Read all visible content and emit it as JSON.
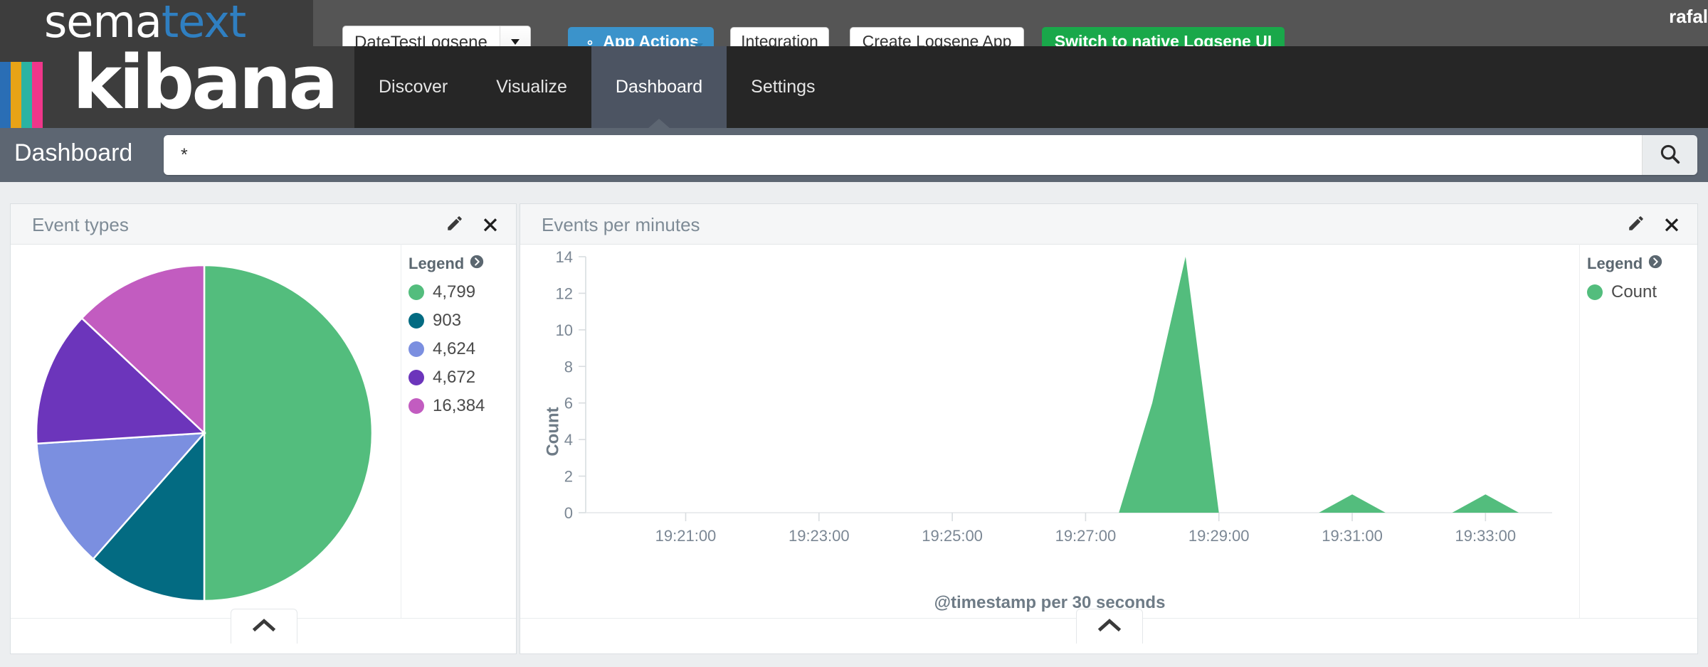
{
  "topbar": {
    "logo": {
      "part1": "sema",
      "part2": "text"
    },
    "app_select": {
      "value": "DateTestLogsene",
      "icon": "chevron-down-icon"
    },
    "buttons": [
      {
        "name": "app-actions",
        "label": "App Actions",
        "icon": "gear-icon",
        "style": "blue"
      },
      {
        "name": "integration",
        "label": "Integration",
        "style": "white"
      },
      {
        "name": "create-logsene-app",
        "label": "Create Logsene App",
        "style": "white"
      },
      {
        "name": "switch-native-ui",
        "label": "Switch to native Logsene UI",
        "style": "green"
      }
    ],
    "username": "rafal"
  },
  "kibana": {
    "logo_word": "kibana",
    "stripe_colors": [
      "#2a6eb5",
      "#e8a317",
      "#2bb3a3",
      "#f0368a"
    ],
    "tabs": [
      {
        "label": "Discover",
        "active": false
      },
      {
        "label": "Visualize",
        "active": false
      },
      {
        "label": "Dashboard",
        "active": true
      },
      {
        "label": "Settings",
        "active": false
      }
    ]
  },
  "search": {
    "page_title": "Dashboard",
    "query": "*",
    "placeholder": "",
    "button_icon": "search-icon"
  },
  "panels": [
    {
      "name": "event-types",
      "title": "Event types",
      "tools": [
        {
          "name": "edit-panel-button",
          "icon": "pencil-icon"
        },
        {
          "name": "remove-panel-button",
          "icon": "close-icon"
        }
      ],
      "legend_title": "Legend",
      "legend_icon": "arrow-circle-right-icon",
      "collapse_icon": "chevron-up-icon"
    },
    {
      "name": "events-per-minutes",
      "title": "Events per minutes",
      "tools": [
        {
          "name": "edit-panel-button",
          "icon": "pencil-icon"
        },
        {
          "name": "remove-panel-button",
          "icon": "close-icon"
        }
      ],
      "legend_title": "Legend",
      "legend_icon": "arrow-circle-right-icon",
      "collapse_icon": "chevron-up-icon"
    }
  ],
  "chart_data": [
    {
      "type": "pie",
      "title": "Event types",
      "labels": [
        "4,799",
        "903",
        "4,624",
        "4,672",
        "16,384"
      ],
      "values": [
        50.0,
        11.5,
        12.5,
        13.0,
        13.0
      ],
      "colors": [
        "#53bd7d",
        "#036b82",
        "#7b8fe0",
        "#6c35bb",
        "#c25cc0"
      ],
      "legend": [
        "4,799",
        "903",
        "4,624",
        "4,672",
        "16,384"
      ],
      "legend_position": "right",
      "start_angle": 0,
      "direction": "clockwise"
    },
    {
      "type": "area",
      "title": "Events per minutes",
      "xlabel": "@timestamp per 30 seconds",
      "ylabel": "Count",
      "ylim": [
        0,
        14
      ],
      "yticks": [
        0,
        2,
        4,
        6,
        8,
        10,
        12,
        14
      ],
      "xticks": [
        "19:21:00",
        "19:23:00",
        "19:25:00",
        "19:27:00",
        "19:29:00",
        "19:31:00",
        "19:33:00"
      ],
      "xlim": [
        "19:19:30",
        "19:34:00"
      ],
      "grid": false,
      "legend": [
        "Count"
      ],
      "legend_position": "right",
      "series": [
        {
          "name": "Count",
          "color": "#53bd7d",
          "x": [
            "19:27:30",
            "19:28:00",
            "19:28:30",
            "19:29:00",
            "19:30:30",
            "19:31:00",
            "19:31:30",
            "19:32:30",
            "19:33:00",
            "19:33:30"
          ],
          "values": [
            0,
            6,
            14,
            0,
            0,
            1,
            0,
            0,
            1,
            0
          ]
        }
      ]
    }
  ]
}
